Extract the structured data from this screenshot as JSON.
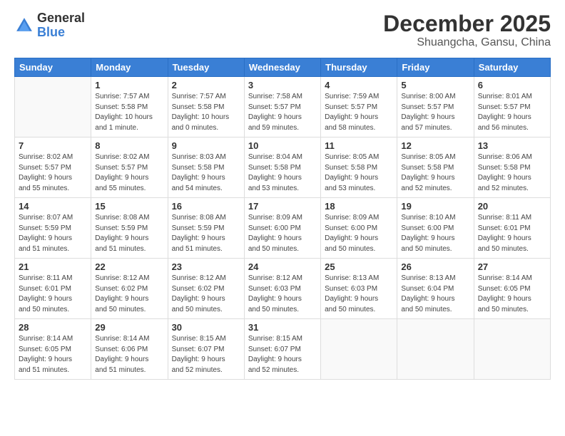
{
  "header": {
    "logo_general": "General",
    "logo_blue": "Blue",
    "month_title": "December 2025",
    "location": "Shuangcha, Gansu, China"
  },
  "days_of_week": [
    "Sunday",
    "Monday",
    "Tuesday",
    "Wednesday",
    "Thursday",
    "Friday",
    "Saturday"
  ],
  "weeks": [
    [
      {
        "day": "",
        "info": ""
      },
      {
        "day": "1",
        "info": "Sunrise: 7:57 AM\nSunset: 5:58 PM\nDaylight: 10 hours\nand 1 minute."
      },
      {
        "day": "2",
        "info": "Sunrise: 7:57 AM\nSunset: 5:58 PM\nDaylight: 10 hours\nand 0 minutes."
      },
      {
        "day": "3",
        "info": "Sunrise: 7:58 AM\nSunset: 5:57 PM\nDaylight: 9 hours\nand 59 minutes."
      },
      {
        "day": "4",
        "info": "Sunrise: 7:59 AM\nSunset: 5:57 PM\nDaylight: 9 hours\nand 58 minutes."
      },
      {
        "day": "5",
        "info": "Sunrise: 8:00 AM\nSunset: 5:57 PM\nDaylight: 9 hours\nand 57 minutes."
      },
      {
        "day": "6",
        "info": "Sunrise: 8:01 AM\nSunset: 5:57 PM\nDaylight: 9 hours\nand 56 minutes."
      }
    ],
    [
      {
        "day": "7",
        "info": "Sunrise: 8:02 AM\nSunset: 5:57 PM\nDaylight: 9 hours\nand 55 minutes."
      },
      {
        "day": "8",
        "info": "Sunrise: 8:02 AM\nSunset: 5:57 PM\nDaylight: 9 hours\nand 55 minutes."
      },
      {
        "day": "9",
        "info": "Sunrise: 8:03 AM\nSunset: 5:58 PM\nDaylight: 9 hours\nand 54 minutes."
      },
      {
        "day": "10",
        "info": "Sunrise: 8:04 AM\nSunset: 5:58 PM\nDaylight: 9 hours\nand 53 minutes."
      },
      {
        "day": "11",
        "info": "Sunrise: 8:05 AM\nSunset: 5:58 PM\nDaylight: 9 hours\nand 53 minutes."
      },
      {
        "day": "12",
        "info": "Sunrise: 8:05 AM\nSunset: 5:58 PM\nDaylight: 9 hours\nand 52 minutes."
      },
      {
        "day": "13",
        "info": "Sunrise: 8:06 AM\nSunset: 5:58 PM\nDaylight: 9 hours\nand 52 minutes."
      }
    ],
    [
      {
        "day": "14",
        "info": "Sunrise: 8:07 AM\nSunset: 5:59 PM\nDaylight: 9 hours\nand 51 minutes."
      },
      {
        "day": "15",
        "info": "Sunrise: 8:08 AM\nSunset: 5:59 PM\nDaylight: 9 hours\nand 51 minutes."
      },
      {
        "day": "16",
        "info": "Sunrise: 8:08 AM\nSunset: 5:59 PM\nDaylight: 9 hours\nand 51 minutes."
      },
      {
        "day": "17",
        "info": "Sunrise: 8:09 AM\nSunset: 6:00 PM\nDaylight: 9 hours\nand 50 minutes."
      },
      {
        "day": "18",
        "info": "Sunrise: 8:09 AM\nSunset: 6:00 PM\nDaylight: 9 hours\nand 50 minutes."
      },
      {
        "day": "19",
        "info": "Sunrise: 8:10 AM\nSunset: 6:00 PM\nDaylight: 9 hours\nand 50 minutes."
      },
      {
        "day": "20",
        "info": "Sunrise: 8:11 AM\nSunset: 6:01 PM\nDaylight: 9 hours\nand 50 minutes."
      }
    ],
    [
      {
        "day": "21",
        "info": "Sunrise: 8:11 AM\nSunset: 6:01 PM\nDaylight: 9 hours\nand 50 minutes."
      },
      {
        "day": "22",
        "info": "Sunrise: 8:12 AM\nSunset: 6:02 PM\nDaylight: 9 hours\nand 50 minutes."
      },
      {
        "day": "23",
        "info": "Sunrise: 8:12 AM\nSunset: 6:02 PM\nDaylight: 9 hours\nand 50 minutes."
      },
      {
        "day": "24",
        "info": "Sunrise: 8:12 AM\nSunset: 6:03 PM\nDaylight: 9 hours\nand 50 minutes."
      },
      {
        "day": "25",
        "info": "Sunrise: 8:13 AM\nSunset: 6:03 PM\nDaylight: 9 hours\nand 50 minutes."
      },
      {
        "day": "26",
        "info": "Sunrise: 8:13 AM\nSunset: 6:04 PM\nDaylight: 9 hours\nand 50 minutes."
      },
      {
        "day": "27",
        "info": "Sunrise: 8:14 AM\nSunset: 6:05 PM\nDaylight: 9 hours\nand 50 minutes."
      }
    ],
    [
      {
        "day": "28",
        "info": "Sunrise: 8:14 AM\nSunset: 6:05 PM\nDaylight: 9 hours\nand 51 minutes."
      },
      {
        "day": "29",
        "info": "Sunrise: 8:14 AM\nSunset: 6:06 PM\nDaylight: 9 hours\nand 51 minutes."
      },
      {
        "day": "30",
        "info": "Sunrise: 8:15 AM\nSunset: 6:07 PM\nDaylight: 9 hours\nand 52 minutes."
      },
      {
        "day": "31",
        "info": "Sunrise: 8:15 AM\nSunset: 6:07 PM\nDaylight: 9 hours\nand 52 minutes."
      },
      {
        "day": "",
        "info": ""
      },
      {
        "day": "",
        "info": ""
      },
      {
        "day": "",
        "info": ""
      }
    ]
  ]
}
